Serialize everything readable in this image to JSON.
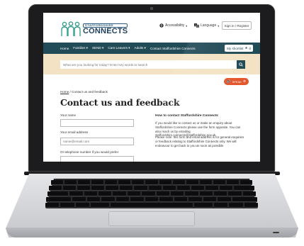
{
  "site": {
    "logo_top": "STAFFORDSHIRE",
    "logo_main": "CONNECTS",
    "accessibility": "Accessibility",
    "language": "Language",
    "signin": "Sign in / Register"
  },
  "nav": {
    "items": [
      "Home",
      "Families",
      "SEND",
      "Care Leavers",
      "Adults",
      "Contact Staffordshire Connects"
    ],
    "shortlist": "My shortlist",
    "shortlist_count": "0"
  },
  "search": {
    "placeholder": "What are you looking for today? Enter key words to search"
  },
  "speak": {
    "label": "SPEAK"
  },
  "breadcrumb": {
    "home": "Home",
    "separator": "/",
    "current": "Contact us and feedback"
  },
  "page": {
    "title": "Contact us and feedback"
  },
  "form": {
    "name_label": "Your name",
    "email_label": "Your email address",
    "email_placeholder": "name@email.com",
    "phone_label": "Or telephone number if you would prefer"
  },
  "info": {
    "title": "How to contact Staffordshire Connects",
    "p1": "If you would like to contact us or make an enquiry about Staffordshire Connects please use the form opposite. You can also reach us by emailing staffordshire.connects@staffordshire.gov.uk",
    "p2": "Please note: this form and email address is for general enquiries or feedback relating to Staffordshire Connects only. We will endeavour to get back to you as soon as possible"
  },
  "colors": {
    "nav_bg": "#214b57",
    "search_band": "#f3e3c4",
    "speak_bg": "#e4572e",
    "logo_blue": "#1f3f5e"
  },
  "icons": [
    "people-logo-icon",
    "accessibility-icon",
    "translate-icon",
    "chevron-down-icon",
    "search-icon",
    "star-icon",
    "speaker-icon"
  ]
}
